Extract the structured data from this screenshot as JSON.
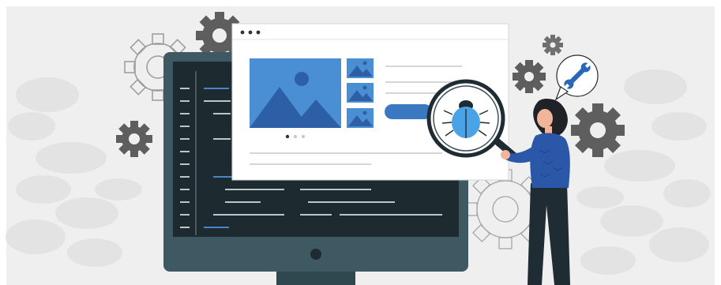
{
  "scene": {
    "subject": "software-debugging-illustration",
    "colors": {
      "background": "#efefef",
      "pattern": "#e2e2e2",
      "gear_dark": "#5e5e5e",
      "gear_outline": "#9a9a9a",
      "monitor_frame": "#3e5961",
      "monitor_screen": "#1d2b30",
      "code_line": "#b9c7cb",
      "code_accent": "#4a83c9",
      "browser_bg": "#ffffff",
      "image_blue": "#4a8fd4",
      "image_dark": "#2c5fa5",
      "button_blue": "#3a78c2",
      "bug_blue": "#4aa3e6",
      "person_shirt": "#2a57a8",
      "person_pants": "#1f2c33",
      "person_hair": "#1f2227",
      "skin": "#f2b59a",
      "wrench_blue": "#2a66b8"
    },
    "icons": [
      "gear-icon",
      "wrench-icon",
      "bug-icon",
      "magnifying-glass-icon",
      "image-placeholder-icon"
    ],
    "carousel": {
      "dot_count": 3,
      "active_index": 0
    }
  }
}
